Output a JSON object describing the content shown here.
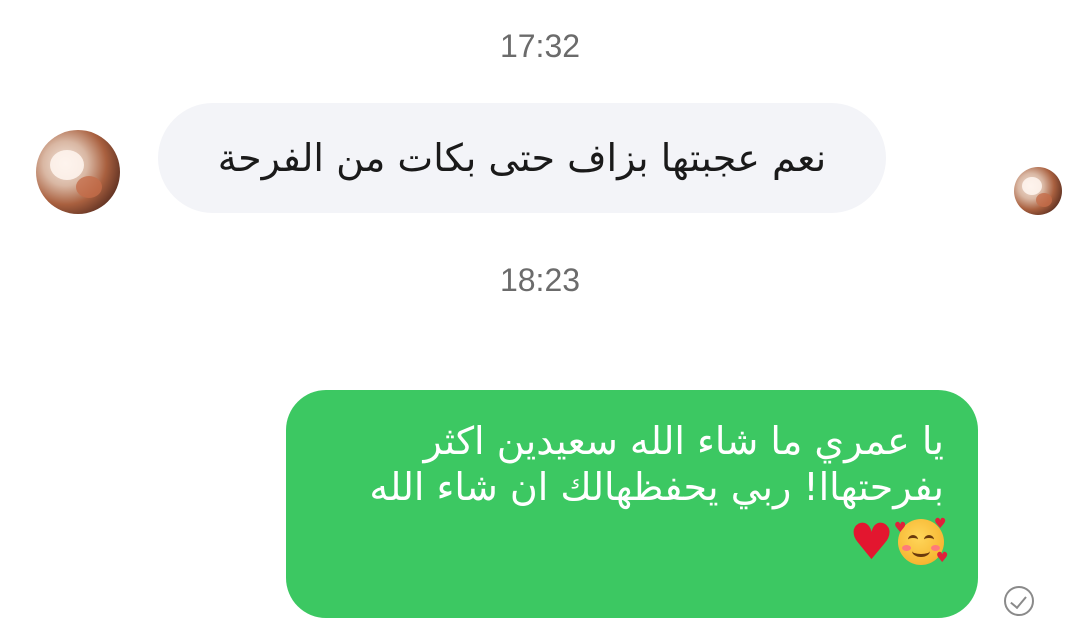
{
  "timestamps": [
    "17:32",
    "18:23"
  ],
  "incoming": {
    "text": "نعم عجبتها بزاف حتى بكات من الفرحة",
    "avatar_icon": "profile-photo"
  },
  "outgoing": {
    "lines": [
      "يا عمري ما شاء الله سعيدين اكثر",
      "بفرحتهاا!  ربي يحفظهالك ان شاء الله"
    ],
    "emojis": [
      "smiling-face-with-hearts",
      "red-heart"
    ],
    "status_icon": "read-check-icon"
  },
  "colors": {
    "outgoing_bubble": "#3cc862",
    "incoming_bubble": "#f3f4f8",
    "timestamp_text": "#6b6b6b"
  }
}
